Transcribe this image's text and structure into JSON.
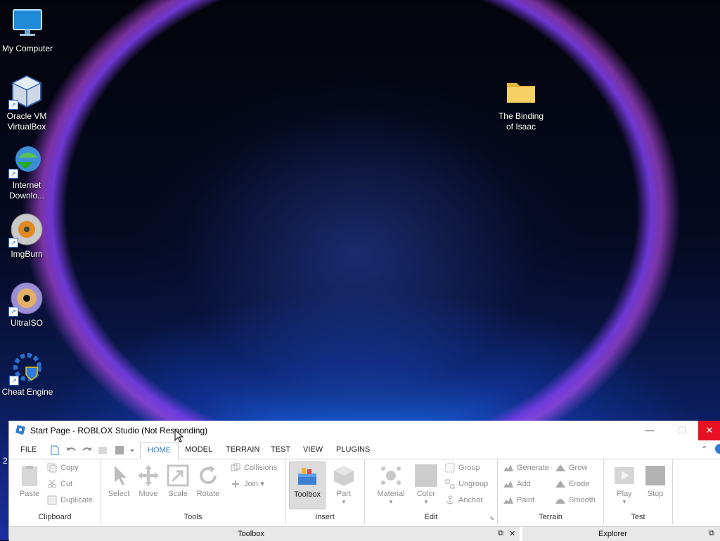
{
  "desktop": {
    "icons": [
      {
        "label": "My Computer",
        "icon": "monitor-icon"
      },
      {
        "label": "Oracle VM VirtualBox",
        "icon": "virtualbox-icon"
      },
      {
        "label": "Internet Downlo...",
        "icon": "idm-icon"
      },
      {
        "label": "ImgBurn",
        "icon": "imgburn-icon"
      },
      {
        "label": "UltraISO",
        "icon": "ultraiso-icon"
      },
      {
        "label": "Cheat Engine",
        "icon": "cheat-engine-icon"
      },
      {
        "label": "The Binding of Isaac",
        "icon": "folder-icon"
      }
    ],
    "partial_clock_text": "2"
  },
  "studio": {
    "title": "Start Page - ROBLOX Studio (Not Responding)",
    "window_buttons": {
      "minimize": "—",
      "maximize": "☐",
      "close": "✕"
    },
    "menu": {
      "file": "FILE",
      "tabs": [
        "HOME",
        "MODEL",
        "TERRAIN",
        "TEST",
        "VIEW",
        "PLUGINS"
      ],
      "active_tab": "HOME"
    },
    "ribbon": {
      "clipboard": {
        "label": "Clipboard",
        "paste": "Paste",
        "copy": "Copy",
        "cut": "Cut",
        "duplicate": "Duplicate"
      },
      "tools": {
        "label": "Tools",
        "select": "Select",
        "move": "Move",
        "scale": "Scale",
        "rotate": "Rotate",
        "collisions": "Collisions",
        "join": "Join"
      },
      "insert": {
        "label": "Insert",
        "toolbox": "Toolbox",
        "part": "Part"
      },
      "edit": {
        "label": "Edit",
        "material": "Material",
        "color": "Color",
        "group": "Group",
        "ungroup": "Ungroup",
        "anchor": "Anchor"
      },
      "terrain": {
        "label": "Terrain",
        "generate": "Generate",
        "add": "Add",
        "paint": "Paint",
        "grow": "Grow",
        "erode": "Erode",
        "smooth": "Smooth"
      },
      "test": {
        "label": "Test",
        "play": "Play",
        "stop": "Stop"
      }
    },
    "panels": {
      "toolbox": "Toolbox",
      "explorer": "Explorer"
    },
    "colors": {
      "accent": "#2b7cd3",
      "close": "#e81123",
      "disabled": "#8d8d8d"
    }
  }
}
